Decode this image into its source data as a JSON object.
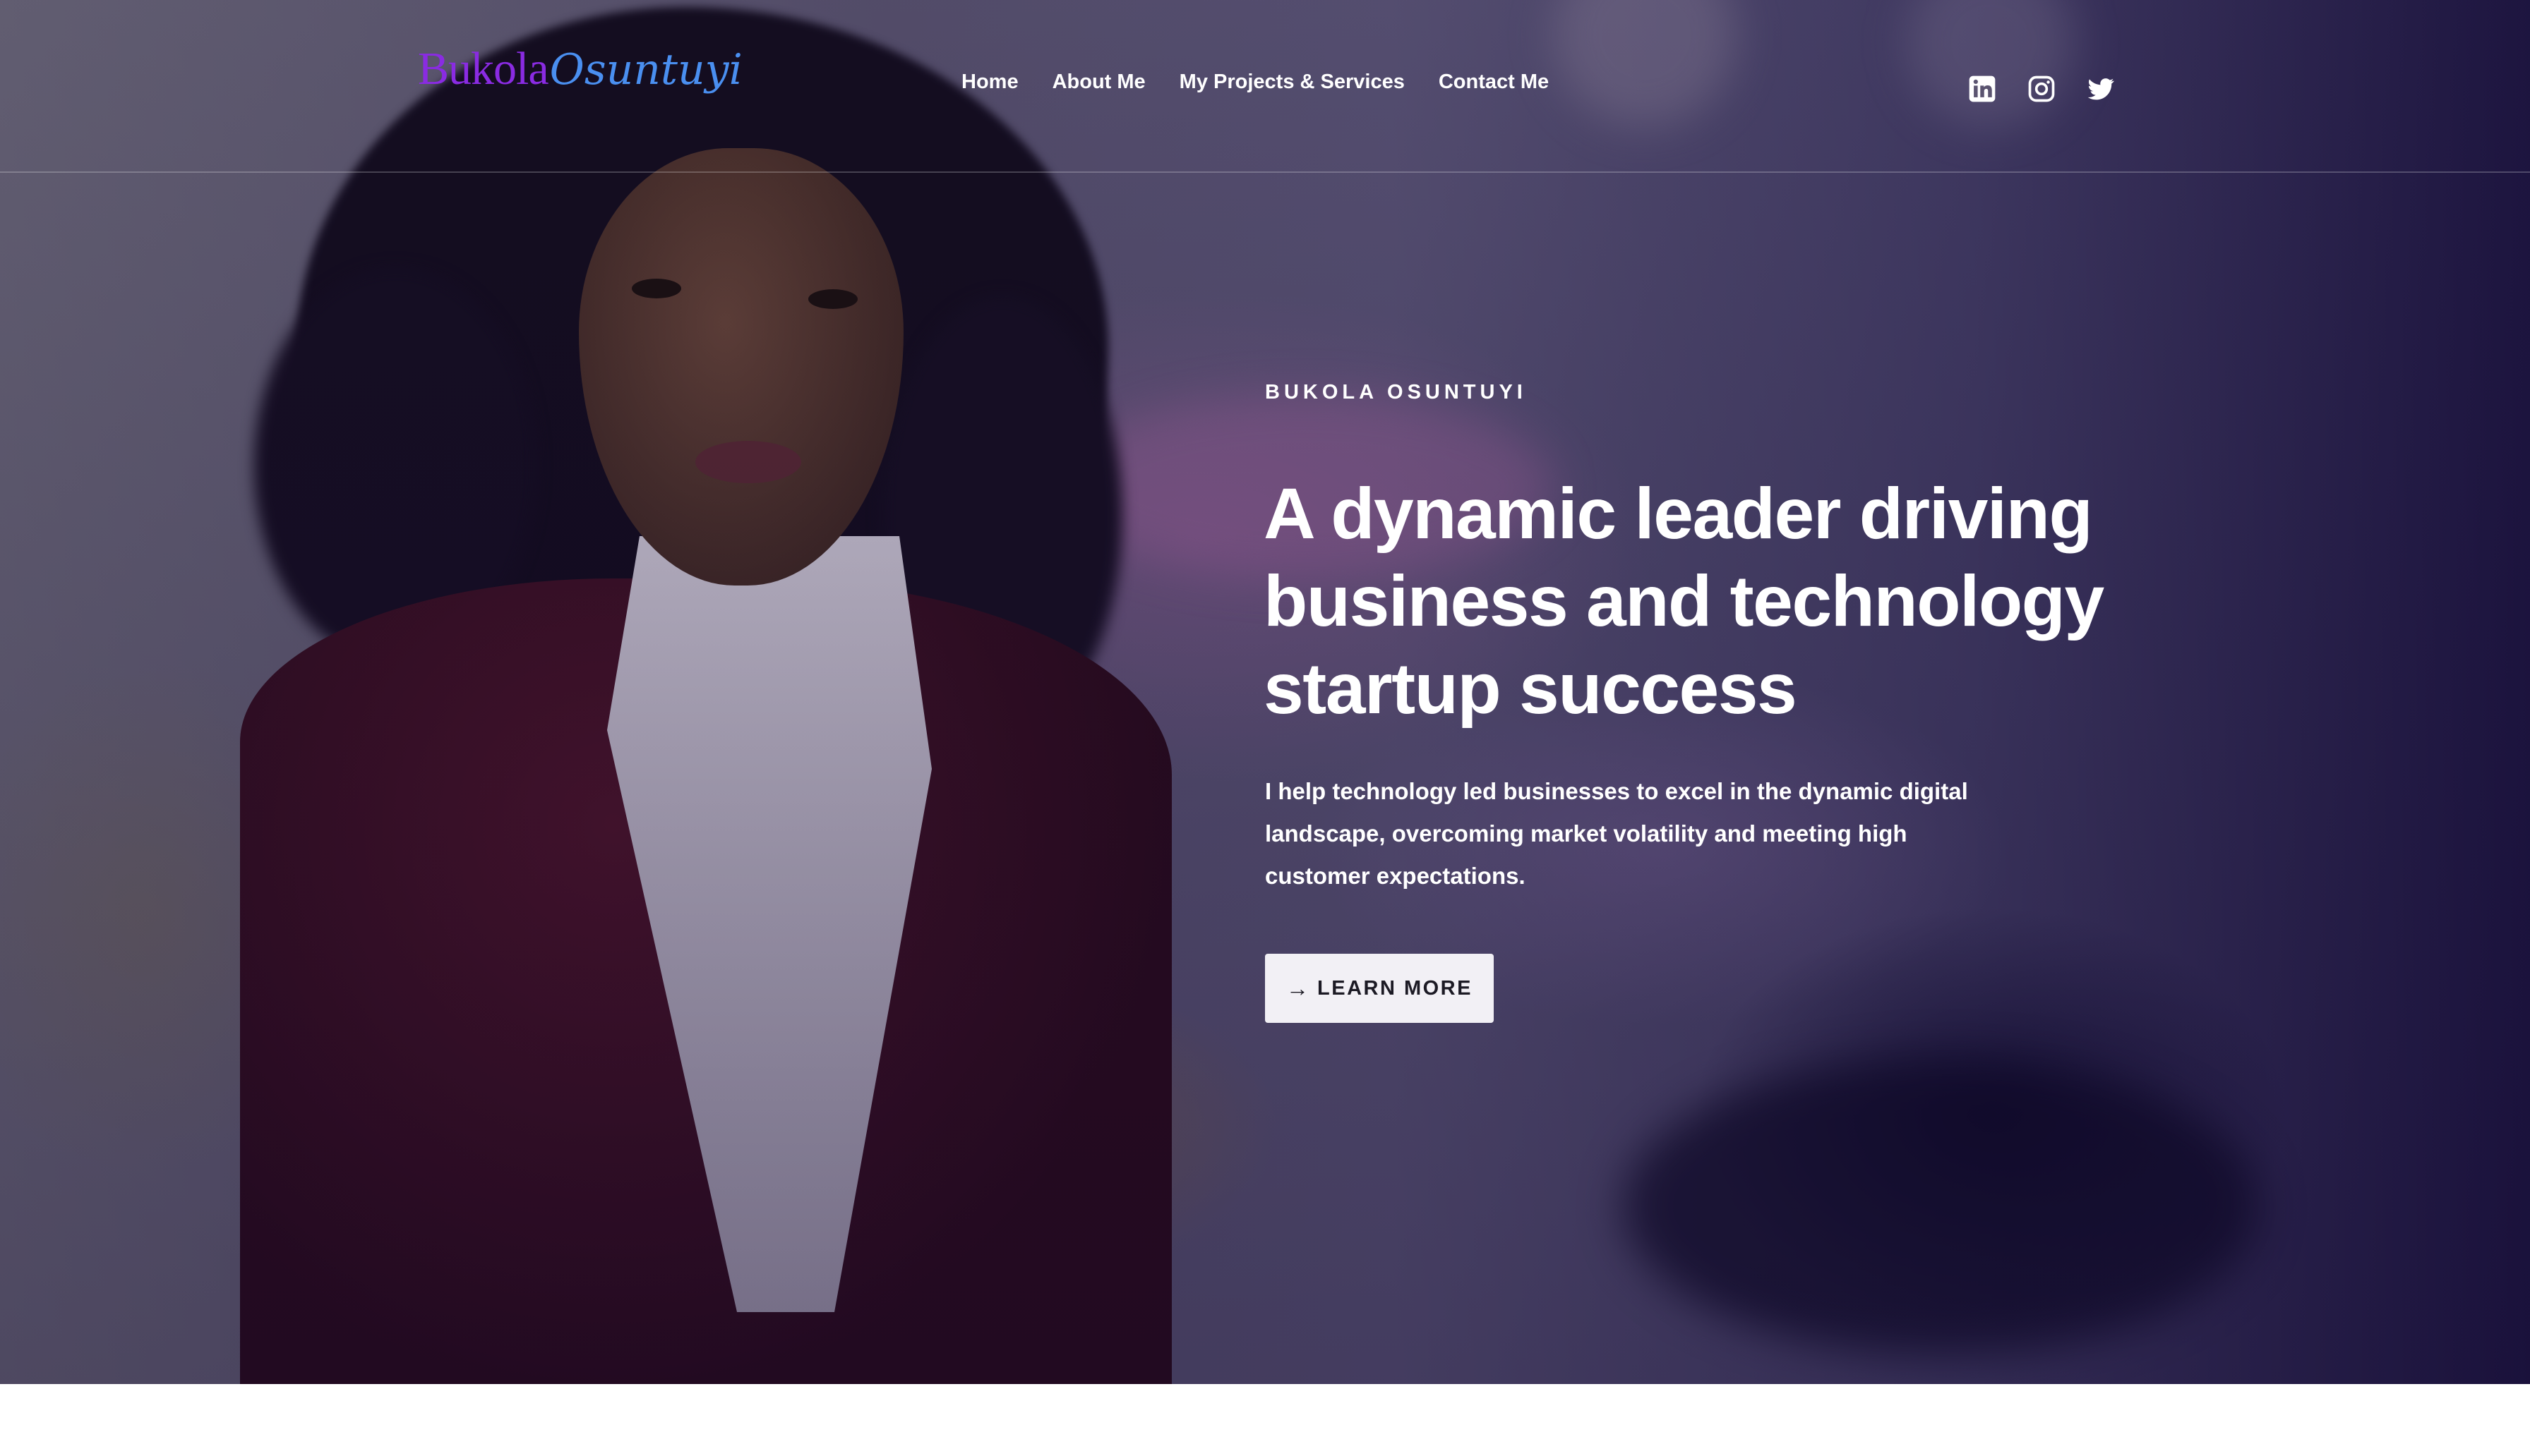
{
  "header": {
    "logo_first": "Bukola",
    "logo_last": "Osuntuyi",
    "nav": [
      {
        "label": "Home"
      },
      {
        "label": "About Me"
      },
      {
        "label": "My Projects & Services"
      },
      {
        "label": "Contact Me"
      }
    ],
    "social_icons": [
      "linkedin-icon",
      "instagram-icon",
      "twitter-icon"
    ]
  },
  "hero": {
    "eyebrow": "BUKOLA OSUNTUYI",
    "headline": "A dynamic leader driving business and technology startup success",
    "subtext": "I help technology led businesses to excel in the dynamic digital landscape, overcoming market volatility and meeting high customer expectations.",
    "cta_label": "LEARN MORE",
    "cta_icon": "arrow-right-icon"
  },
  "colors": {
    "logo_first": "#8a2be2",
    "logo_last": "#4a8ff0",
    "cta_bg": "#f2f0f5",
    "text": "#ffffff"
  }
}
